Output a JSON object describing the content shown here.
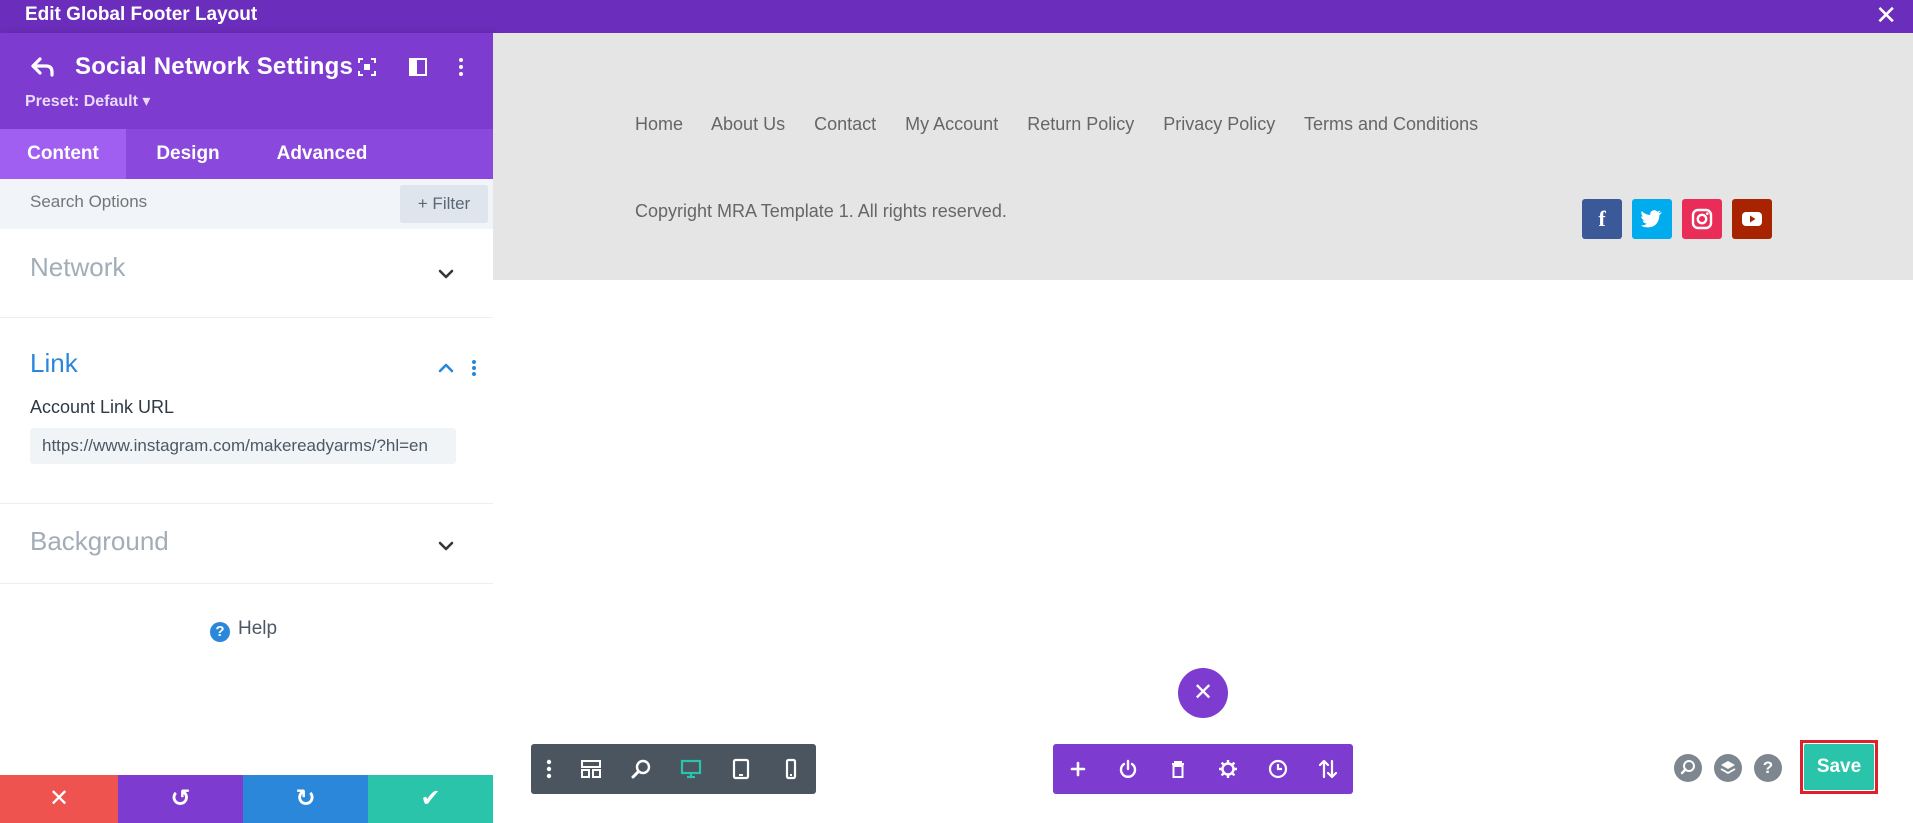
{
  "window": {
    "title": "Edit Global Footer Layout",
    "close_label": "✕"
  },
  "panel": {
    "title": "Social Network Settings",
    "preset": "Preset: Default ▾",
    "tabs": [
      {
        "label": "Content",
        "active": true
      },
      {
        "label": "Design",
        "active": false
      },
      {
        "label": "Advanced",
        "active": false
      }
    ],
    "search": {
      "placeholder": "Search Options",
      "filter_label": "+ Filter"
    },
    "sections": {
      "network": {
        "title": "Network",
        "expanded": false
      },
      "link": {
        "title": "Link",
        "expanded": true,
        "field_label": "Account Link URL",
        "field_value": "https://www.instagram.com/makereadyarms/?hl=en"
      },
      "background": {
        "title": "Background",
        "expanded": false
      }
    },
    "help_label": "Help",
    "help_icon_glyph": "?",
    "bottom_buttons": [
      {
        "name": "discard",
        "glyph": "✕",
        "color": "#ef5350"
      },
      {
        "name": "undo",
        "glyph": "↺",
        "color": "#7e3bd0"
      },
      {
        "name": "redo",
        "glyph": "↻",
        "color": "#2b87da"
      },
      {
        "name": "save-panel",
        "glyph": "✔",
        "color": "#29c4a9"
      }
    ]
  },
  "footer_preview": {
    "nav_links": [
      "Home",
      "About Us",
      "Contact",
      "My Account",
      "Return Policy",
      "Privacy Policy",
      "Terms and Conditions"
    ],
    "copyright": "Copyright MRA Template 1. All rights reserved.",
    "social": [
      {
        "network": "facebook",
        "glyph": "f",
        "color": "#3b5998"
      },
      {
        "network": "twitter",
        "glyph": "t",
        "color": "#00aced"
      },
      {
        "network": "instagram",
        "glyph": "◎",
        "color": "#ea2c59"
      },
      {
        "network": "youtube",
        "glyph": "▶",
        "color": "#a82400"
      }
    ]
  },
  "builder": {
    "fab_close_glyph": "✕",
    "save_label": "Save",
    "colors": {
      "accent": "#7e3bd0",
      "save": "#29c4a9",
      "highlight": "#e0202a",
      "active_view": "#29c4a9"
    }
  }
}
